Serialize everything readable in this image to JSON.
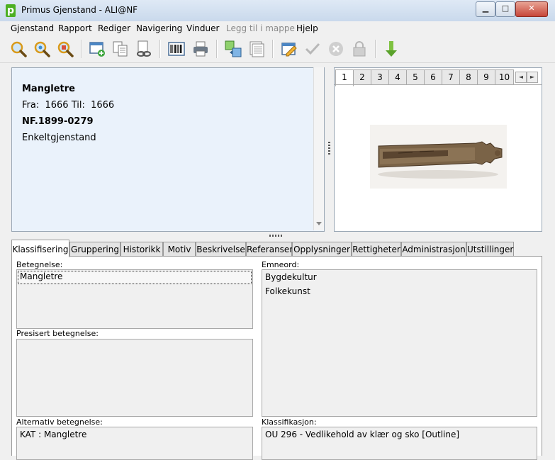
{
  "window": {
    "title": "Primus Gjenstand - ALI@NF",
    "logo_letter": "p",
    "minimize_glyph": "▁",
    "maximize_glyph": "□",
    "close_glyph": "✕"
  },
  "menu": [
    "Gjenstand",
    "Rapport",
    "Rediger",
    "Navigering",
    "Vinduer",
    "Legg til i mappe",
    "Hjelp"
  ],
  "menu_disabled": "Legg til i mappe",
  "toolbar": {
    "icons": [
      "search-icon",
      "search-icon",
      "search-advanced-icon",
      "new-record-icon",
      "copy-record-icon",
      "link-record-icon",
      "barcode-icon",
      "print-icon",
      "transfer-icon",
      "list-icon",
      "edit-icon",
      "approve-icon",
      "cancel-icon",
      "lock-icon",
      "download-arrow-icon"
    ]
  },
  "summary": {
    "title": "Mangletre",
    "dates": "Fra:  1666 Til:  1666",
    "identifier": "NF.1899-0279",
    "object_type": "Enkeltgjenstand"
  },
  "image_panel": {
    "tabs": [
      "1",
      "2",
      "3",
      "4",
      "5",
      "6",
      "7",
      "8",
      "9",
      "10"
    ],
    "active_tab": "1",
    "nav_prev": "◄",
    "nav_next": "►"
  },
  "tabs": [
    "Klassifisering",
    "Gruppering",
    "Historikk",
    "Motiv",
    "Beskrivelse",
    "Referanser",
    "Opplysninger",
    "Rettigheter",
    "Administrasjon",
    "Utstillinger"
  ],
  "active_tab": "Klassifisering",
  "classification": {
    "betegnelse_label": "Betegnelse:",
    "betegnelse_value": "Mangletre",
    "presisert_label": "Presisert betegnelse:",
    "presisert_value": "",
    "alternativ_label": "Alternativ betegnelse:",
    "alternativ_value": "KAT : Mangletre",
    "emneord_label": "Emneord:",
    "emneord": [
      "Bygdekultur",
      "Folkekunst"
    ],
    "klassifikasjon_label": "Klassifikasjon:",
    "klassifikasjon_value": "OU 296 - Vedlikehold av klær og sko [Outline]"
  },
  "colors": {
    "summary_bg": "#eaf2fb",
    "accent_green": "#4caf22"
  }
}
